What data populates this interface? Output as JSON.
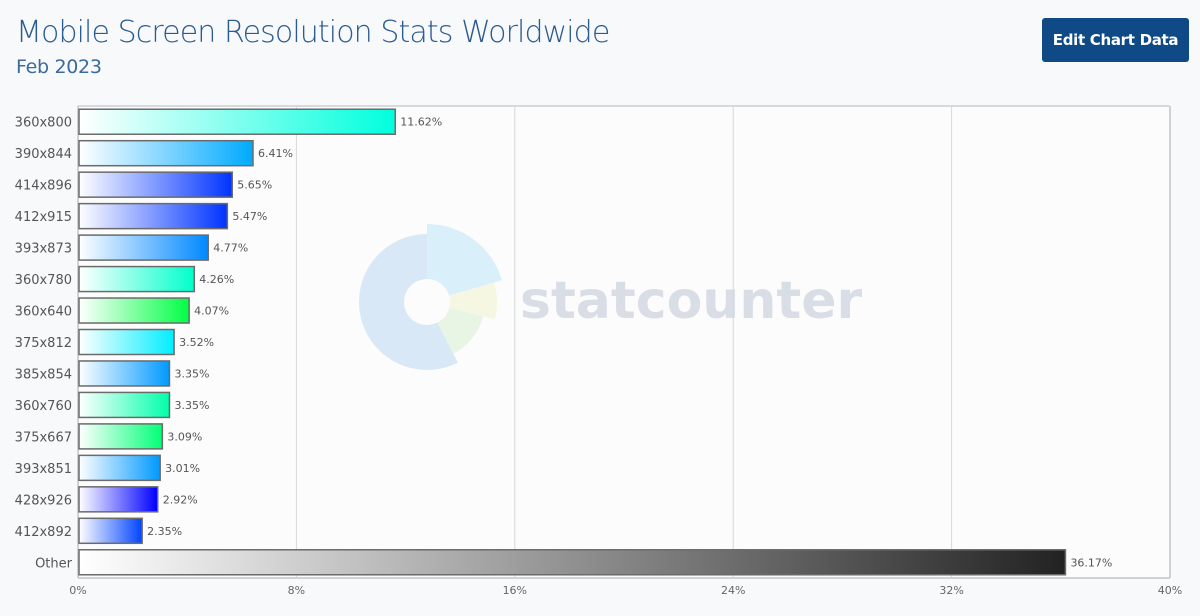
{
  "header": {
    "title": "Mobile Screen Resolution Stats Worldwide",
    "subtitle": "Feb 2023",
    "edit_button": "Edit Chart Data"
  },
  "watermark": {
    "text": "statcounter",
    "icon": "statcounter-logo-icon"
  },
  "chart_data": {
    "type": "bar",
    "orientation": "horizontal",
    "title": "Mobile Screen Resolution Stats Worldwide",
    "subtitle": "Feb 2023",
    "xlabel": "",
    "ylabel": "",
    "xlim": [
      0,
      40
    ],
    "x_ticks": [
      "0%",
      "8%",
      "16%",
      "24%",
      "32%",
      "40%"
    ],
    "x_tick_values": [
      0,
      8,
      16,
      24,
      32,
      40
    ],
    "grid": "vertical",
    "categories": [
      "360x800",
      "390x844",
      "414x896",
      "412x915",
      "393x873",
      "360x780",
      "360x640",
      "375x812",
      "385x854",
      "360x760",
      "375x667",
      "393x851",
      "428x926",
      "412x892",
      "Other"
    ],
    "values": [
      11.62,
      6.41,
      5.65,
      5.47,
      4.77,
      4.26,
      4.07,
      3.52,
      3.35,
      3.35,
      3.09,
      3.01,
      2.92,
      2.35,
      36.17
    ],
    "value_labels": [
      "11.62%",
      "6.41%",
      "5.65%",
      "5.47%",
      "4.77%",
      "4.26%",
      "4.07%",
      "3.52%",
      "3.35%",
      "3.35%",
      "3.09%",
      "3.01%",
      "2.92%",
      "2.35%",
      "36.17%"
    ],
    "bar_colors": [
      "#00ffdd",
      "#00aaff",
      "#0033ff",
      "#0033ff",
      "#0088ff",
      "#00ffcc",
      "#00ff44",
      "#00eeff",
      "#0099ff",
      "#00ffaa",
      "#00ff77",
      "#0099ff",
      "#0000ff",
      "#0044ff",
      "#222222"
    ]
  }
}
